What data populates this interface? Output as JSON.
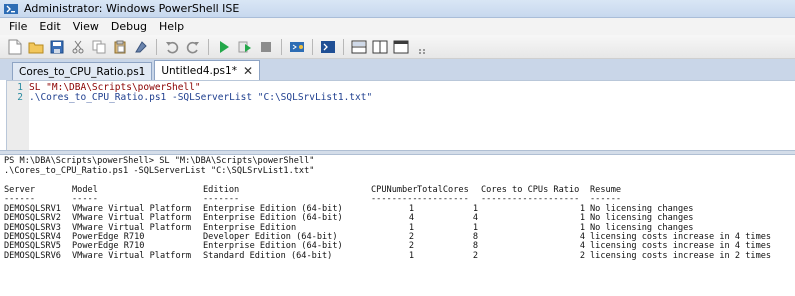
{
  "window": {
    "title": "Administrator: Windows PowerShell ISE"
  },
  "menu": [
    "File",
    "Edit",
    "View",
    "Debug",
    "Help"
  ],
  "toolbar": {
    "icons": [
      "new-icon",
      "open-icon",
      "save-icon",
      "cut-icon",
      "copy-icon",
      "paste-icon",
      "clear-icon",
      "undo-icon",
      "redo-icon",
      "run-icon",
      "run-selection-icon",
      "stop-icon",
      "remote-powershell-icon",
      "powershell-console-icon",
      "layout-top-icon",
      "layout-right-icon",
      "layout-max-icon",
      "more-icon"
    ]
  },
  "tabs": [
    {
      "label": "Cores_to_CPU_Ratio.ps1",
      "active": false
    },
    {
      "label": "Untitled4.ps1*",
      "active": true,
      "close": "✕"
    }
  ],
  "editor": {
    "lines": [
      {
        "number": "1",
        "text": "SL \"M:\\DBA\\Scripts\\powerShell\""
      },
      {
        "number": "2",
        "text": ".\\Cores_to_CPU_Ratio.ps1 -SQLServerList \"C:\\SQLSrvList1.txt\""
      }
    ]
  },
  "console": {
    "prompt_line": "PS M:\\DBA\\Scripts\\powerShell> SL \"M:\\DBA\\Scripts\\powerShell\"",
    "command_line": ".\\Cores_to_CPU_Ratio.ps1 -SQLServerList \"C:\\SQLSrvList1.txt\"",
    "table": {
      "headers": [
        "Server",
        "Model",
        "Edition",
        "CPUNumber",
        "TotalCores",
        "Cores to CPUs Ratio",
        "Resume"
      ],
      "dashes": [
        "------",
        "-----",
        "-------",
        "---------",
        "----------",
        "-------------------",
        "------"
      ],
      "rows": [
        [
          "DEMOSQLSRV1",
          "VMware Virtual Platform",
          "Enterprise Edition (64-bit)",
          "1",
          "1",
          "1",
          "No licensing changes"
        ],
        [
          "DEMOSQLSRV2",
          "VMware Virtual Platform",
          "Enterprise Edition (64-bit)",
          "4",
          "4",
          "1",
          "No licensing changes"
        ],
        [
          "DEMOSQLSRV3",
          "VMware Virtual Platform",
          "Enterprise Edition",
          "1",
          "1",
          "1",
          "No licensing changes"
        ],
        [
          "DEMOSQLSRV4",
          "PowerEdge R710",
          "Developer Edition (64-bit)",
          "2",
          "8",
          "4",
          "licensing costs increase in 4 times"
        ],
        [
          "DEMOSQLSRV5",
          "PowerEdge R710",
          "Enterprise Edition (64-bit)",
          "2",
          "8",
          "4",
          "licensing costs increase in 4 times"
        ],
        [
          "DEMOSQLSRV6",
          "VMware Virtual Platform",
          "Standard Edition (64-bit)",
          "1",
          "2",
          "2",
          "licensing costs increase in 2 times"
        ]
      ]
    }
  }
}
